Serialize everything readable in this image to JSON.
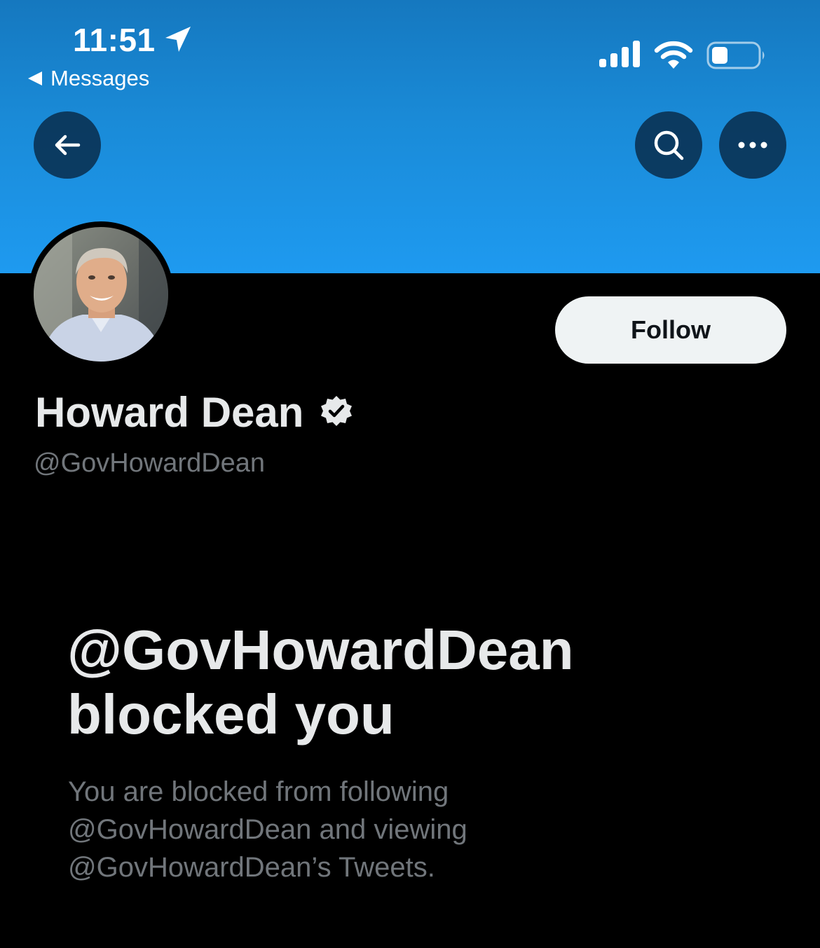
{
  "status_bar": {
    "time": "11:51",
    "back_app_label": "Messages"
  },
  "icons": {
    "location": "location-arrow-icon",
    "signal": "cellular-signal-icon",
    "wifi": "wifi-icon",
    "battery": "battery-icon",
    "back": "arrow-left-icon",
    "search": "search-icon",
    "more": "more-options-icon",
    "verified": "verified-badge-icon"
  },
  "colors": {
    "banner_top": "#1578bf",
    "banner_bottom": "#1e9af0",
    "background": "#000000",
    "follow_button_bg": "#eff3f4",
    "primary_text": "#e7e9ea",
    "secondary_text": "#71767b"
  },
  "profile": {
    "display_name": "Howard Dean",
    "handle": "@GovHowardDean",
    "follow_label": "Follow"
  },
  "blocked": {
    "title": "@GovHowardDean blocked you",
    "description": "You are blocked from following @GovHowardDean and viewing @GovHowardDean’s Tweets."
  }
}
